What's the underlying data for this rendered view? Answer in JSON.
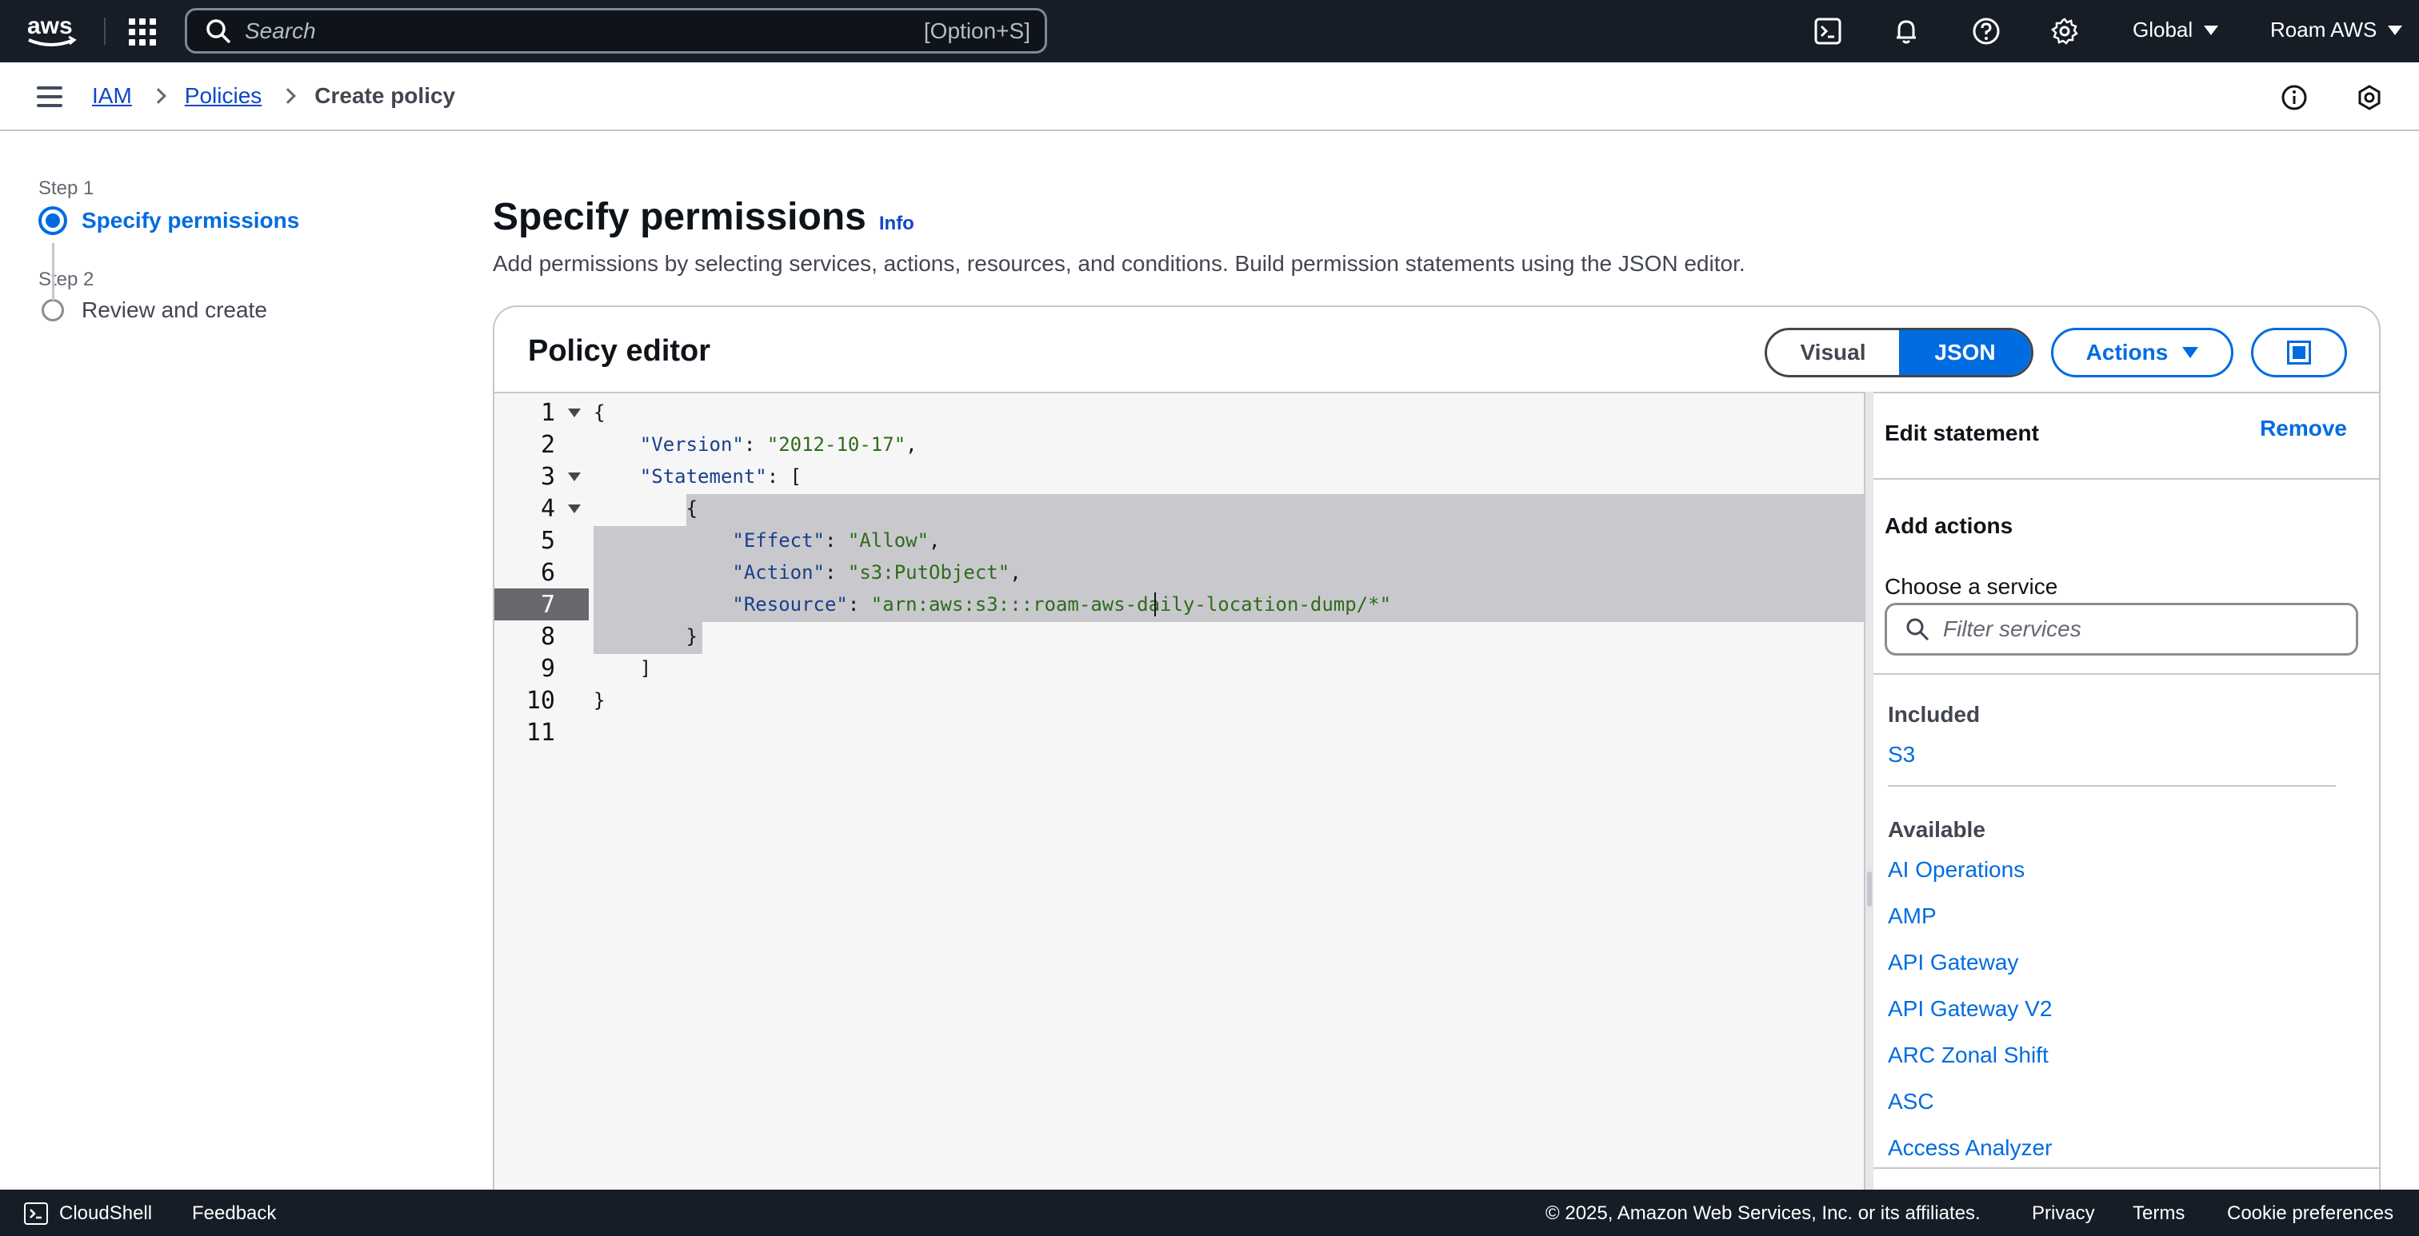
{
  "topnav": {
    "search_placeholder": "Search",
    "search_shortcut": "[Option+S]",
    "region": "Global",
    "account": "Roam AWS",
    "icons": [
      "cloudshell-icon",
      "bell-icon",
      "help-icon",
      "gear-icon"
    ]
  },
  "breadcrumb": {
    "items": [
      "IAM",
      "Policies"
    ],
    "current": "Create policy"
  },
  "steps": [
    {
      "label": "Step 1",
      "title": "Specify permissions",
      "active": true
    },
    {
      "label": "Step 2",
      "title": "Review and create",
      "active": false
    }
  ],
  "page": {
    "title": "Specify permissions",
    "info": "Info",
    "description": "Add permissions by selecting services, actions, resources, and conditions. Build permission statements using the JSON editor."
  },
  "editor": {
    "title": "Policy editor",
    "modes": [
      "Visual",
      "JSON"
    ],
    "active_mode": "JSON",
    "actions_label": "Actions",
    "line_numbers": [
      "1",
      "2",
      "3",
      "4",
      "5",
      "6",
      "7",
      "8",
      "9",
      "10",
      "11"
    ],
    "current_line": "7",
    "lines": [
      "{",
      "    \"Version\": \"2012-10-17\",",
      "    \"Statement\": [",
      "        {",
      "            \"Effect\": \"Allow\",",
      "            \"Action\": \"s3:PutObject\",",
      "            \"Resource\": \"arn:aws:s3:::roam-aws-daily-location-dump/*\"",
      "        }",
      "    ]",
      "}",
      ""
    ]
  },
  "statement_panel": {
    "title": "Edit statement",
    "remove_label": "Remove",
    "add_actions": "Add actions",
    "choose_service": "Choose a service",
    "filter_placeholder": "Filter services",
    "included_heading": "Included",
    "included": [
      "S3"
    ],
    "available_heading": "Available",
    "available": [
      "AI Operations",
      "AMP",
      "API Gateway",
      "API Gateway V2",
      "ARC Zonal Shift",
      "ASC",
      "Access Analyzer"
    ]
  },
  "footer": {
    "cloudshell": "CloudShell",
    "feedback": "Feedback",
    "copyright": "© 2025, Amazon Web Services, Inc. or its affiliates.",
    "privacy": "Privacy",
    "terms": "Terms",
    "cookies": "Cookie preferences"
  },
  "colors": {
    "nav_bg": "#161d26",
    "accent": "#006ce0",
    "link": "#0f47c7",
    "selection": "#c9c9cd"
  }
}
